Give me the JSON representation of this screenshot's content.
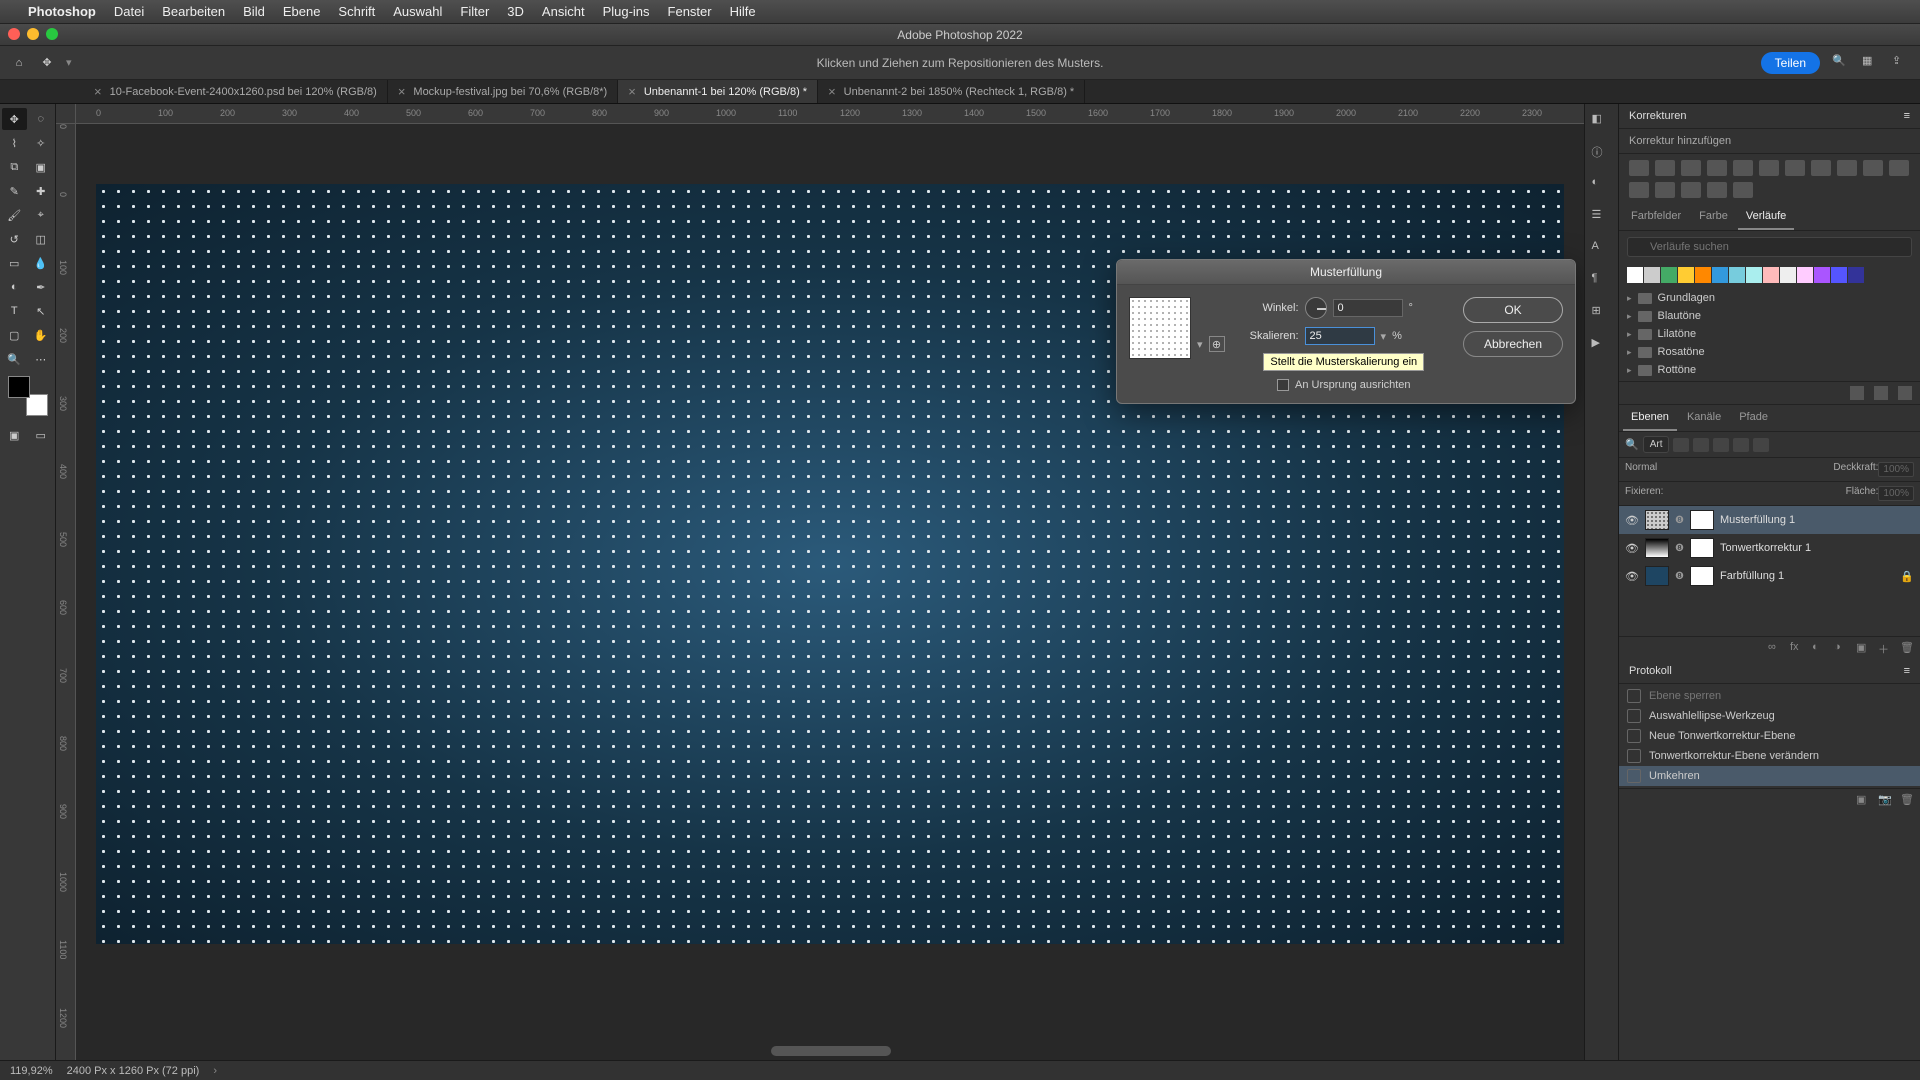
{
  "menubar": {
    "app": "Photoshop",
    "items": [
      "Datei",
      "Bearbeiten",
      "Bild",
      "Ebene",
      "Schrift",
      "Auswahl",
      "Filter",
      "3D",
      "Ansicht",
      "Plug-ins",
      "Fenster",
      "Hilfe"
    ]
  },
  "window_title": "Adobe Photoshop 2022",
  "optionsbar_hint": "Klicken und Ziehen zum Repositionieren des Musters.",
  "share_label": "Teilen",
  "tabs": [
    {
      "label": "10-Facebook-Event-2400x1260.psd bei 120% (RGB/8)",
      "active": false
    },
    {
      "label": "Mockup-festival.jpg bei 70,6% (RGB/8*)",
      "active": false
    },
    {
      "label": "Unbenannt-1 bei 120% (RGB/8) *",
      "active": true
    },
    {
      "label": "Unbenannt-2 bei 1850% (Rechteck 1, RGB/8) *",
      "active": false
    }
  ],
  "ruler_marks": [
    "0",
    "100",
    "200",
    "300",
    "400",
    "500",
    "600",
    "700",
    "800",
    "900",
    "1000",
    "1100",
    "1200",
    "1300",
    "1400",
    "1500",
    "1600",
    "1700",
    "1800",
    "1900",
    "2000",
    "2100",
    "2200",
    "2300"
  ],
  "ruler_v_marks": [
    "0",
    "0",
    "100",
    "200",
    "300",
    "400",
    "500",
    "600",
    "700",
    "800",
    "900",
    "1000",
    "1100",
    "1200"
  ],
  "dialog": {
    "title": "Musterfüllung",
    "angle_label": "Winkel:",
    "angle_value": "0",
    "angle_unit": "°",
    "scale_label": "Skalieren:",
    "scale_value": "25",
    "scale_unit": "%",
    "tooltip": "Stellt die Musterskalierung ein",
    "align_label": "An Ursprung ausrichten",
    "ok": "OK",
    "cancel": "Abbrechen"
  },
  "korrekturen": {
    "title": "Korrekturen",
    "add": "Korrektur hinzufügen"
  },
  "swatch_tabs": [
    "Farbfelder",
    "Farbe",
    "Verläufe"
  ],
  "swatch_active": 2,
  "search_placeholder": "Verläufe suchen",
  "swatch_colors": [
    "#ffffff",
    "#cccccc",
    "#4a6",
    "#fc3",
    "#f80",
    "#39d",
    "#7cd",
    "#aee",
    "#fbb",
    "#eee",
    "#fcf",
    "#a5f",
    "#55f",
    "#339"
  ],
  "folders": [
    "Grundlagen",
    "Blautöne",
    "Lilatöne",
    "Rosatöne",
    "Rottöne"
  ],
  "layers_tabs": [
    "Ebenen",
    "Kanäle",
    "Pfade"
  ],
  "layers_active": 0,
  "layers_filter_label": "Art",
  "blend_mode": "Normal",
  "opacity_label": "Deckkraft:",
  "opacity_value": "100%",
  "lock_label": "Fixieren:",
  "fill_label": "Fläche:",
  "fill_value": "100%",
  "layers": [
    {
      "name": "Musterfüllung 1",
      "selected": true,
      "type": "pattern"
    },
    {
      "name": "Tonwertkorrektur 1",
      "selected": false,
      "type": "levels"
    },
    {
      "name": "Farbfüllung 1",
      "selected": false,
      "type": "fill",
      "locked": true
    }
  ],
  "history_title": "Protokoll",
  "history": [
    {
      "label": "Ebene sperren",
      "dim": true
    },
    {
      "label": "Auswahlellipse-Werkzeug",
      "dim": false
    },
    {
      "label": "Neue Tonwertkorrektur-Ebene",
      "dim": false
    },
    {
      "label": "Tonwertkorrektur-Ebene verändern",
      "dim": false
    },
    {
      "label": "Umkehren",
      "dim": false,
      "selected": true
    }
  ],
  "status": {
    "zoom": "119,92%",
    "dims": "2400 Px x 1260 Px (72 ppi)"
  }
}
